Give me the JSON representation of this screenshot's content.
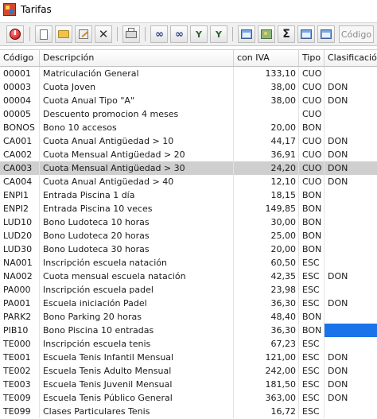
{
  "window": {
    "title": "Tarifas"
  },
  "toolbar": {
    "buttons": [
      {
        "icon": "power-icon"
      },
      {
        "icon": "new-document-icon"
      },
      {
        "icon": "open-folder-icon"
      },
      {
        "icon": "edit-icon"
      },
      {
        "icon": "delete-icon"
      },
      {
        "icon": "print-icon"
      },
      {
        "icon": "find-icon"
      },
      {
        "icon": "find-next-icon"
      },
      {
        "icon": "filter-icon"
      },
      {
        "icon": "filter-clear-icon"
      },
      {
        "icon": "export-icon"
      },
      {
        "icon": "image-icon"
      },
      {
        "icon": "sum-icon"
      },
      {
        "icon": "window-icon"
      },
      {
        "icon": "save-window-icon"
      }
    ],
    "codigo_label": "Código"
  },
  "grid": {
    "columns": [
      "Código",
      "Descripción",
      "con IVA",
      "Tipo",
      "Clasificación"
    ],
    "selected_row": 8,
    "highlight_color": "#1a73e8",
    "selection_color": "#cfcfcf",
    "rows": [
      {
        "codigo": "00001",
        "descripcion": "Matriculación General",
        "con_iva": "133,10",
        "tipo": "CUO",
        "clasificacion": ""
      },
      {
        "codigo": "00003",
        "descripcion": "Cuota Joven",
        "con_iva": "38,00",
        "tipo": "CUO",
        "clasificacion": "DON"
      },
      {
        "codigo": "00004",
        "descripcion": "Cuota Anual Tipo \"A\"",
        "con_iva": "38,00",
        "tipo": "CUO",
        "clasificacion": "DON"
      },
      {
        "codigo": "00005",
        "descripcion": "Descuento promocion 4 meses",
        "con_iva": "",
        "tipo": "CUO",
        "clasificacion": ""
      },
      {
        "codigo": "BONOS",
        "descripcion": "Bono 10 accesos",
        "con_iva": "20,00",
        "tipo": "BON",
        "clasificacion": ""
      },
      {
        "codigo": "CA001",
        "descripcion": "Cuota Anual Antigüedad > 10",
        "con_iva": "44,17",
        "tipo": "CUO",
        "clasificacion": "DON"
      },
      {
        "codigo": "CA002",
        "descripcion": "Cuota Mensual Antigüedad > 20",
        "con_iva": "36,91",
        "tipo": "CUO",
        "clasificacion": "DON"
      },
      {
        "codigo": "CA003",
        "descripcion": "Cuota Mensual Antigüedad > 30",
        "con_iva": "24,20",
        "tipo": "CUO",
        "clasificacion": "DON"
      },
      {
        "codigo": "CA004",
        "descripcion": "Cuota Anual Antigüedad > 40",
        "con_iva": "12,10",
        "tipo": "CUO",
        "clasificacion": "DON"
      },
      {
        "codigo": "ENPI1",
        "descripcion": "Entrada Piscina 1 día",
        "con_iva": "18,15",
        "tipo": "BON",
        "clasificacion": ""
      },
      {
        "codigo": "ENPI2",
        "descripcion": "Entrada Piscina 10 veces",
        "con_iva": "149,85",
        "tipo": "BON",
        "clasificacion": ""
      },
      {
        "codigo": "LUD10",
        "descripcion": "Bono Ludoteca 10 horas",
        "con_iva": "30,00",
        "tipo": "BON",
        "clasificacion": ""
      },
      {
        "codigo": "LUD20",
        "descripcion": "Bono Ludoteca 20 horas",
        "con_iva": "25,00",
        "tipo": "BON",
        "clasificacion": ""
      },
      {
        "codigo": "LUD30",
        "descripcion": "Bono Ludoteca 30 horas",
        "con_iva": "20,00",
        "tipo": "BON",
        "clasificacion": ""
      },
      {
        "codigo": "NA001",
        "descripcion": "Inscripción escuela natación",
        "con_iva": "60,50",
        "tipo": "ESC",
        "clasificacion": ""
      },
      {
        "codigo": "NA002",
        "descripcion": "Cuota mensual escuela natación",
        "con_iva": "42,35",
        "tipo": "ESC",
        "clasificacion": "DON"
      },
      {
        "codigo": "PA000",
        "descripcion": "Inscripción escuela padel",
        "con_iva": "23,98",
        "tipo": "ESC",
        "clasificacion": ""
      },
      {
        "codigo": "PA001",
        "descripcion": "Escuela iniciación Padel",
        "con_iva": "36,30",
        "tipo": "ESC",
        "clasificacion": "DON"
      },
      {
        "codigo": "PARK2",
        "descripcion": "Bono Parking 20 horas",
        "con_iva": "48,40",
        "tipo": "BON",
        "clasificacion": ""
      },
      {
        "codigo": "PIB10",
        "descripcion": "Bono Piscina 10 entradas",
        "con_iva": "36,30",
        "tipo": "BON",
        "clasificacion": ""
      },
      {
        "codigo": "TE000",
        "descripcion": "Inscripción escuela tenis",
        "con_iva": "67,23",
        "tipo": "ESC",
        "clasificacion": ""
      },
      {
        "codigo": "TE001",
        "descripcion": "Escuela Tenis Infantil Mensual",
        "con_iva": "121,00",
        "tipo": "ESC",
        "clasificacion": "DON"
      },
      {
        "codigo": "TE002",
        "descripcion": "Escuela Tenis Adulto Mensual",
        "con_iva": "242,00",
        "tipo": "ESC",
        "clasificacion": "DON"
      },
      {
        "codigo": "TE003",
        "descripcion": "Escuela Tenis Juvenil Mensual",
        "con_iva": "181,50",
        "tipo": "ESC",
        "clasificacion": "DON"
      },
      {
        "codigo": "TE009",
        "descripcion": "Escuela Tenis Público General",
        "con_iva": "363,00",
        "tipo": "ESC",
        "clasificacion": "DON"
      },
      {
        "codigo": "TE099",
        "descripcion": "Clases Particulares Tenis",
        "con_iva": "16,72",
        "tipo": "ESC",
        "clasificacion": ""
      }
    ]
  }
}
